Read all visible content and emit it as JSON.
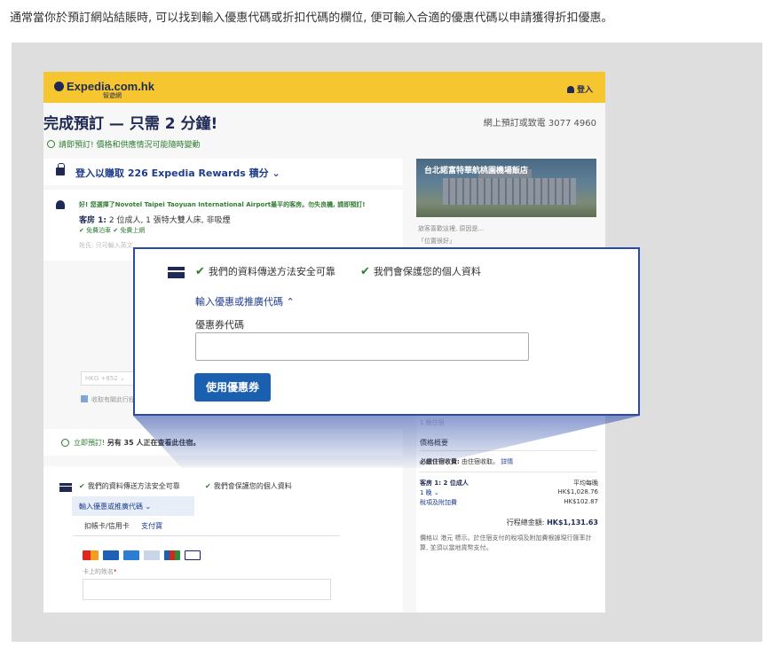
{
  "intro": "通常當你於預訂網站結賬時, 可以找到輸入優惠代碼或折扣代碼的欄位, 便可輸入合適的優惠代碼以申請獲得折扣優惠。",
  "site": {
    "logo": "Expedia.com.hk",
    "logo_sub": "智遊網",
    "login": "登入"
  },
  "checkout": {
    "title": "完成預訂 — 只需 2 分鐘!",
    "phone": "網上預訂或致電 3077 4960",
    "warning": "請即預訂! 價格和供應情況可能隨時變動",
    "rewards": "登入以賺取 226 Expedia Rewards 積分 ⌄",
    "good_choice": "好! 您選擇了Novotel Taipei Taoyuan International Airport最平的客房。勿失良機, 請即預訂!",
    "room_label": "客房 1:",
    "room_desc": "2 位成人, 1 張特大雙人床, 非吸煙",
    "perks": "✔ 免費泊車  ✔ 免費上網",
    "name_hint": "姓氏: 只可輸入英文",
    "country_code": "HKG +852 ⌄",
    "newsletter": "收取有關此行程的短訊",
    "viewing_prefix": "立即預訂!",
    "viewing": "另有 35 人正在查看此住宿。"
  },
  "payment": {
    "secure1": "我們的資料傳送方法安全可靠",
    "secure2": "我們會保護您的個人資料",
    "promo_toggle": "輸入優惠或推廣代碼 ⌄",
    "tab_card": "扣帳卡/信用卡",
    "tab_alipay": "支付寶",
    "name_label": "卡上的姓名",
    "required_mark": "*"
  },
  "hotel": {
    "name": "台北諾富特華航桃園機場飯店",
    "note1": "旅客喜歡這裡, 原因是...",
    "note2": "「位置很好」"
  },
  "summary": {
    "nights_short": "1 晚住宿",
    "title": "價格概要",
    "fee_label": "必繳住宿收費:",
    "fee_value": "由住宿收取。",
    "fee_link": "詳情",
    "room_line": "客房 1: 2 位成人",
    "avg_label": "平均每晚",
    "nights": "1 晚 ⌄",
    "nights_price": "HK$1,028.76",
    "tax_label": "稅項及附加費",
    "tax_price": "HK$102.87",
    "total_label": "行程總金額:",
    "total_value": "HK$1,131.63",
    "note": "價格以 港元 標示。於住宿支付的稅項及附加費根據現行匯率計算, 並須以當地貨幣支付。"
  },
  "zoom": {
    "secure1": "我們的資料傳送方法安全可靠",
    "secure2": "我們會保護您的個人資料",
    "toggle": "輸入優惠或推廣代碼 ⌃",
    "coupon_label": "優惠券代碼",
    "coupon_value": "",
    "apply": "使用優惠券"
  }
}
